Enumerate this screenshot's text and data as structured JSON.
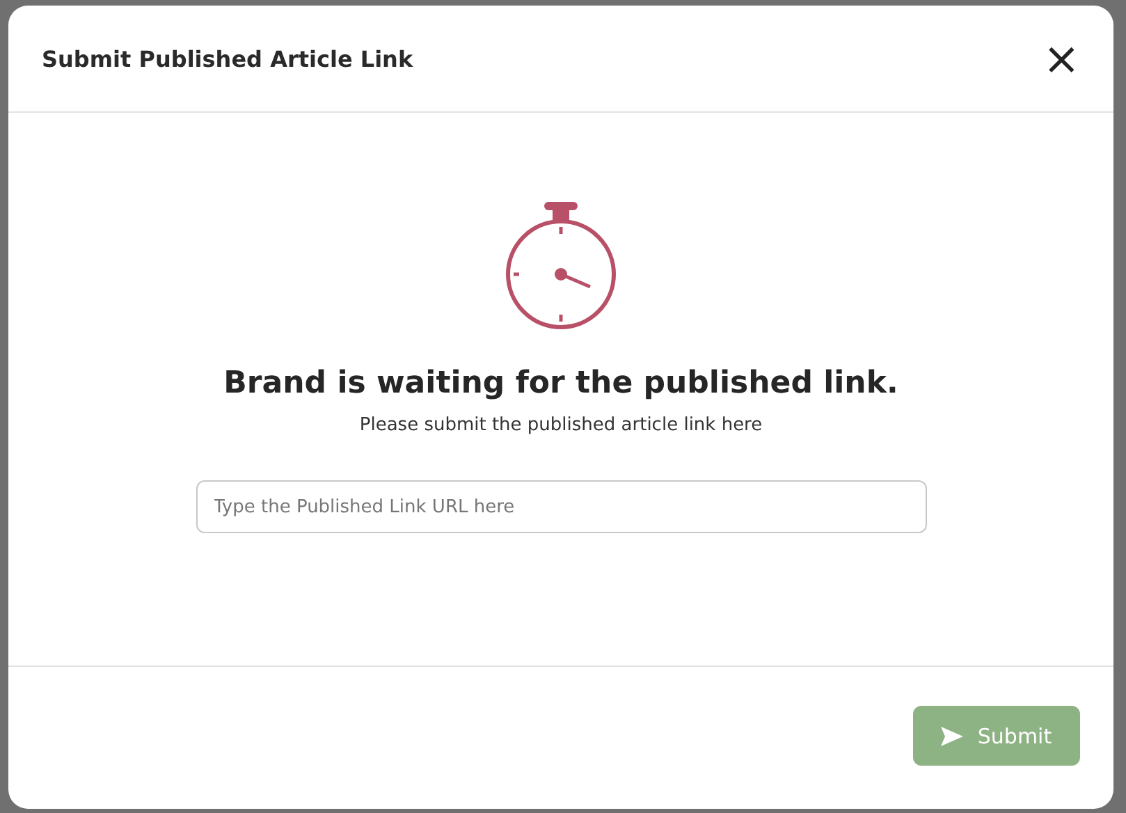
{
  "dialog": {
    "title": "Submit Published Article Link",
    "close_label": "×"
  },
  "message": {
    "heading": "Brand is waiting for the published link.",
    "subtext": "Please submit the published article link here"
  },
  "link_field": {
    "placeholder": "Type the Published Link URL here"
  },
  "submit_button": {
    "label": "Submit",
    "disabled": true
  }
}
